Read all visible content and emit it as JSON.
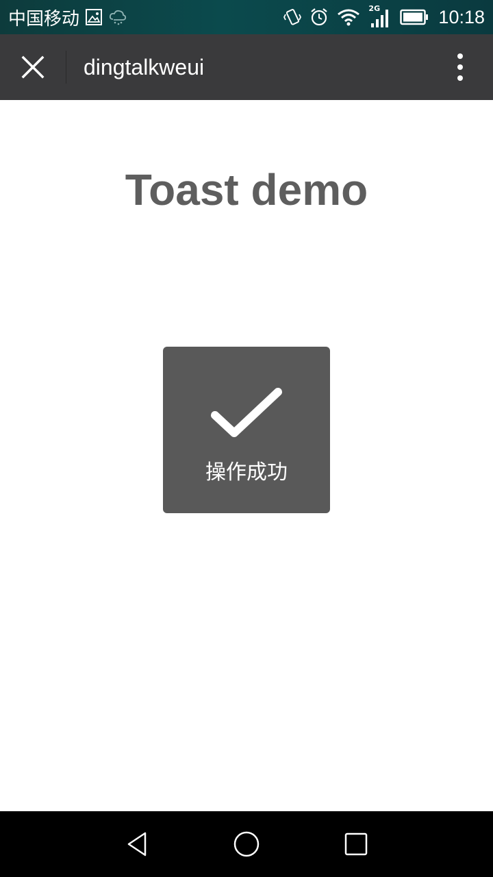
{
  "status_bar": {
    "carrier": "中国移动",
    "network_type": "2G",
    "time": "10:18",
    "icons": [
      "image-icon",
      "cloud-icon",
      "vibrate-icon",
      "alarm-icon",
      "wifi-icon",
      "signal-icon",
      "battery-icon"
    ]
  },
  "app_bar": {
    "title": "dingtalkweui",
    "close_icon": "close-icon",
    "more_icon": "more-vertical-icon"
  },
  "page": {
    "title": "Toast demo"
  },
  "toast": {
    "icon": "checkmark-icon",
    "message": "操作成功"
  },
  "nav_bar": {
    "buttons": [
      "back-icon",
      "home-icon",
      "recents-icon"
    ]
  },
  "colors": {
    "status_bar": "#0b4a4d",
    "app_bar": "#3a3a3c",
    "toast_bg": "#595959",
    "title_text": "#5e5e5e",
    "nav_bar": "#000000"
  }
}
